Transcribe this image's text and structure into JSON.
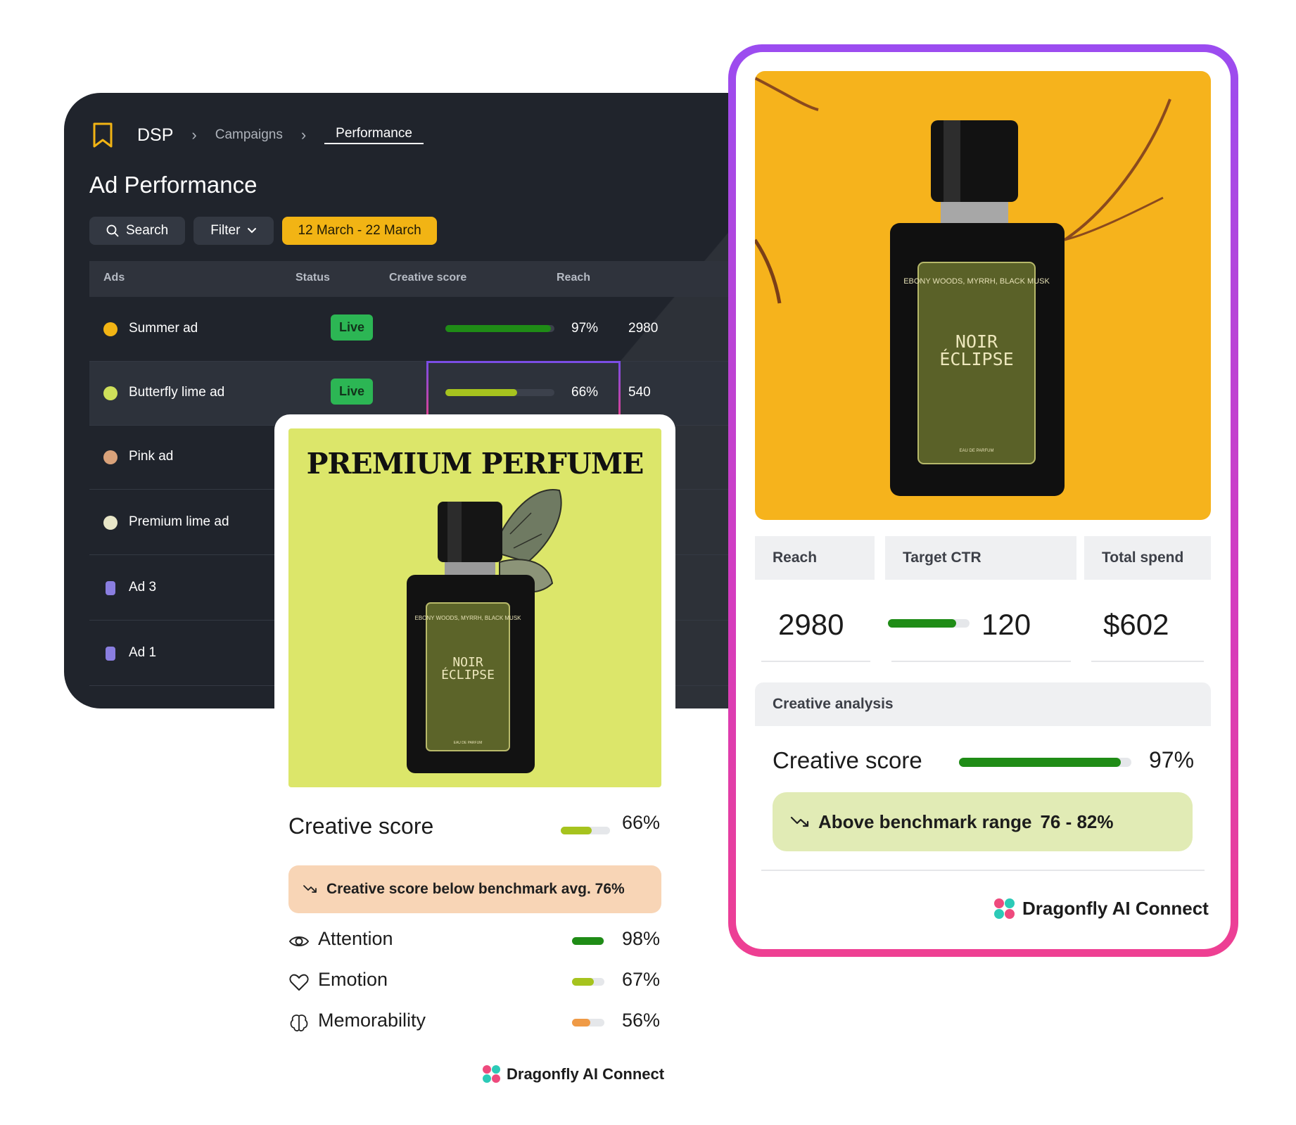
{
  "dashboard": {
    "breadcrumb": {
      "app": "DSP",
      "campaigns": "Campaigns",
      "current": "Performance"
    },
    "title": "Ad Performance",
    "search_label": "Search",
    "filter_label": "Filter",
    "date_range": "12 March - 22 March",
    "columns": {
      "ads": "Ads",
      "status": "Status",
      "creative_score": "Creative score",
      "reach": "Reach"
    },
    "rows": [
      {
        "name": "Summer ad",
        "status": "Live",
        "score": "97%",
        "score_value": 0.97,
        "reach": "2980",
        "icon_color": "#f2b414"
      },
      {
        "name": "Butterfly lime ad",
        "status": "Live",
        "score": "66%",
        "score_value": 0.66,
        "reach": "540",
        "icon_color": "#cfe05a"
      },
      {
        "name": "Pink ad",
        "icon_color": "#d9a27a"
      },
      {
        "name": "Premium lime ad",
        "icon_color": "#e8e6c8"
      },
      {
        "name": "Ad 3",
        "icon_color": "#8a7ee0"
      },
      {
        "name": "Ad 1",
        "icon_color": "#8a7ee0"
      }
    ],
    "colors": {
      "background": "#20242c",
      "accent": "#f2b414",
      "live": "#2cb654",
      "bar_green": "#1f8c16",
      "bar_lime": "#a6c31e"
    }
  },
  "creative_card": {
    "headline": "PREMIUM PERFUME",
    "bottle_notes": "EBONY WOODS, MYRRH, BLACK MUSK",
    "bottle_name_1": "NOIR",
    "bottle_name_2": "ÉCLIPSE",
    "bottle_type": "EAU DE PARFUM",
    "creative_score_label": "Creative score",
    "creative_score": "66%",
    "creative_score_value": 0.66,
    "alert": "Creative score below benchmark avg. 76%",
    "metrics": [
      {
        "label": "Attention",
        "value": "98%",
        "fill": 0.98,
        "color": "#1f8c16",
        "icon": "eye-icon"
      },
      {
        "label": "Emotion",
        "value": "67%",
        "fill": 0.67,
        "color": "#a6c31e",
        "icon": "heart-icon"
      },
      {
        "label": "Memorability",
        "value": "56%",
        "fill": 0.56,
        "color": "#ef9a46",
        "icon": "brain-icon"
      }
    ],
    "brand": "Dragonfly AI Connect"
  },
  "detail_card": {
    "bottle_notes": "EBONY WOODS, MYRRH, BLACK MUSK",
    "bottle_name_1": "NOIR",
    "bottle_name_2": "ÉCLIPSE",
    "bottle_type": "EAU DE PARFUM",
    "kpis": {
      "reach_label": "Reach",
      "reach": "2980",
      "ctr_label": "Target CTR",
      "ctr": "120",
      "ctr_fill": 0.84,
      "spend_label": "Total spend",
      "spend": "$602"
    },
    "analysis_label": "Creative analysis",
    "creative_score_label": "Creative score",
    "creative_score": "97%",
    "creative_score_value": 0.97,
    "benchmark_label": "Above benchmark range",
    "benchmark_range": "76 - 82%",
    "brand": "Dragonfly AI Connect",
    "colors": {
      "frame_top": "#9b4cf0",
      "frame_bottom": "#ee3f92",
      "image_bg": "#f6b31c"
    }
  }
}
